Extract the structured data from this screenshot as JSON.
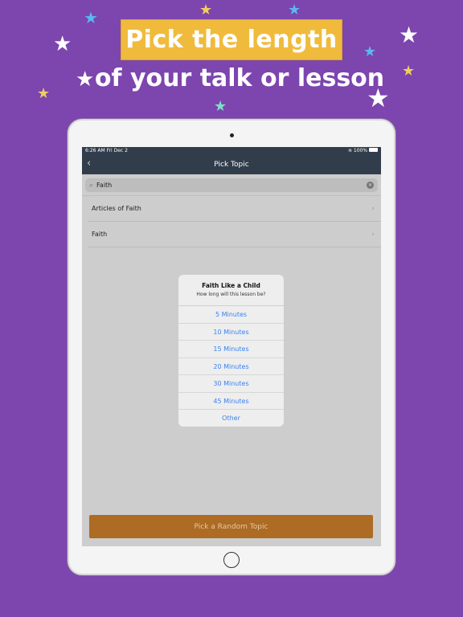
{
  "banner": {
    "title": "Pick the length",
    "subtitle": "of your talk or lesson"
  },
  "colors": {
    "background": "#7d45ae",
    "title_box": "#f0bb3c",
    "nav_bar": "#323d4c",
    "accent_blue": "#3a82f0",
    "random_button": "#ad6b24"
  },
  "status_bar": {
    "time": "6:26 AM   Fri Dec 2",
    "battery": "100%"
  },
  "nav": {
    "title": "Pick Topic",
    "back_icon": "chevron-left-icon"
  },
  "search": {
    "value": "Faith",
    "icon": "search-icon"
  },
  "topics": [
    {
      "label": "Articles of Faith"
    },
    {
      "label": "Faith"
    }
  ],
  "dialog": {
    "title": "Faith Like a Child",
    "message": "How long will this lesson be?",
    "options": [
      "5 Minutes",
      "10 Minutes",
      "15 Minutes",
      "20 Minutes",
      "30 Minutes",
      "45 Minutes",
      "Other"
    ]
  },
  "random_button": "Pick a Random Topic"
}
